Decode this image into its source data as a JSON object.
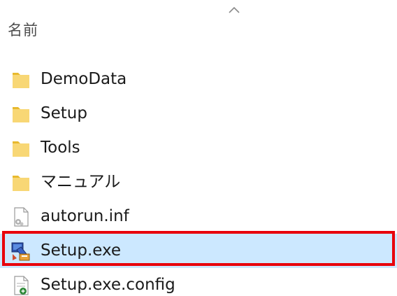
{
  "header": {
    "column_name_label": "名前",
    "sort_direction": "ascending"
  },
  "files": [
    {
      "name": "DemoData",
      "icon": "folder-icon"
    },
    {
      "name": "Setup",
      "icon": "folder-icon"
    },
    {
      "name": "Tools",
      "icon": "folder-icon"
    },
    {
      "name": "マニュアル",
      "icon": "folder-icon"
    },
    {
      "name": "autorun.inf",
      "icon": "settings-file-icon"
    },
    {
      "name": "Setup.exe",
      "icon": "installer-icon",
      "selected": true
    },
    {
      "name": "Setup.exe.config",
      "icon": "config-file-icon"
    }
  ],
  "colors": {
    "selection_background": "#cce8ff",
    "highlight_outline": "#e8000b",
    "folder": "#f8d775"
  }
}
